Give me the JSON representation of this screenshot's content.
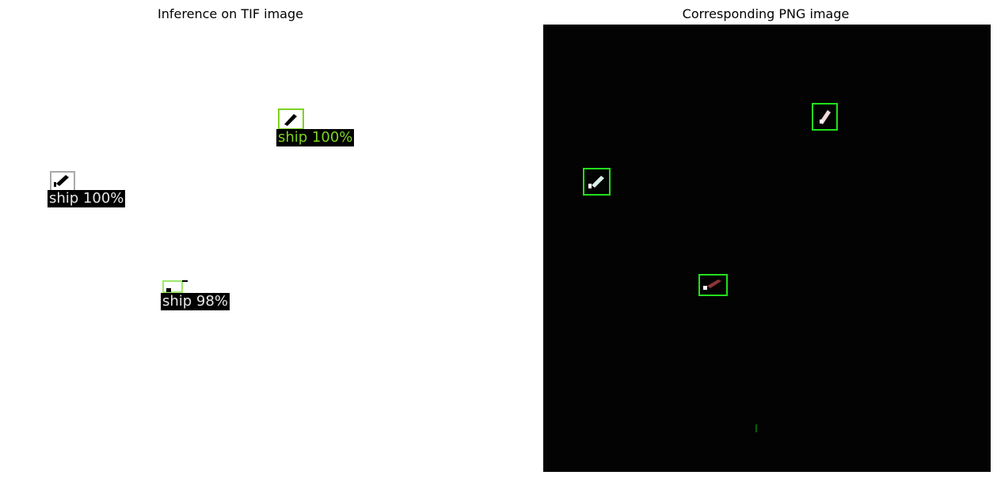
{
  "titles": {
    "left": "Inference on TIF image",
    "right": "Corresponding PNG image"
  },
  "tif_detections": [
    {
      "label": "ship 100%",
      "color": "#7ed321"
    },
    {
      "label": "ship 100%",
      "color": "#d9d9d9"
    },
    {
      "label": "ship 98%",
      "color": "#d9d9d9"
    }
  ],
  "png_detection_count": 3,
  "colors": {
    "png_background": "#020302",
    "png_box": "#22e01c",
    "ship_top_label": "#7ed321",
    "ship_box_gray": "#a9a9a9",
    "ship_box_light_green": "#9be86a"
  }
}
